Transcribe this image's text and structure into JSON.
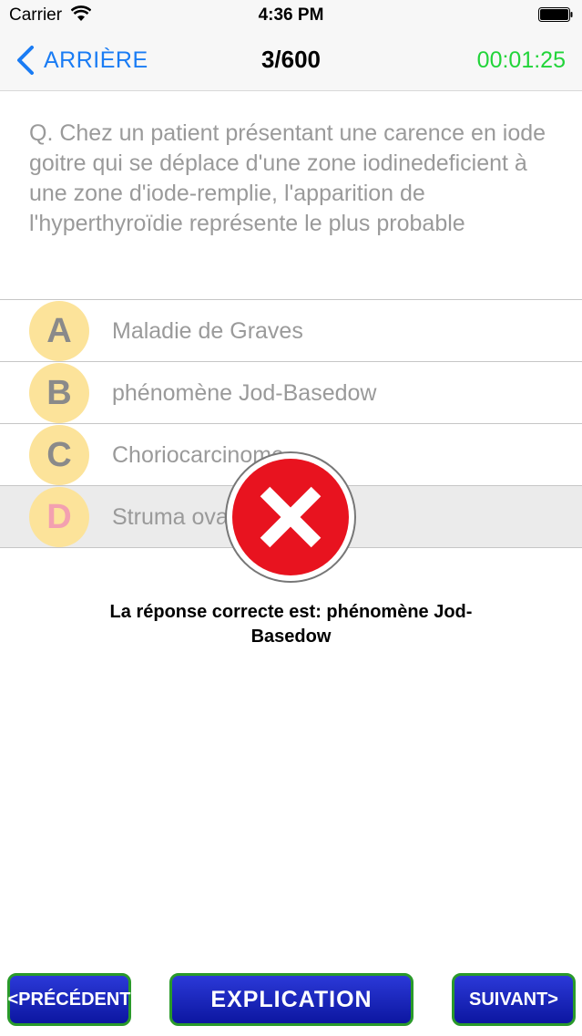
{
  "status_bar": {
    "carrier": "Carrier",
    "time": "4:36 PM"
  },
  "nav": {
    "back_label": "ARRIÈRE",
    "progress": "3/600",
    "timer": "00:01:25"
  },
  "question": {
    "text": "Q. Chez un patient présentant une carence en iode goitre qui se déplace d'une zone iodinedeficient à une zone d'iode-remplie, l'apparition de l'hyperthyroïdie représente le plus probable"
  },
  "options": [
    {
      "letter": "A",
      "text": "Maladie de Graves"
    },
    {
      "letter": "B",
      "text": "phénomène Jod-Basedow"
    },
    {
      "letter": "C",
      "text": "Choriocarcinome"
    },
    {
      "letter": "D",
      "text": "Struma ovarii",
      "selected": true
    }
  ],
  "answer": {
    "text": "La réponse correcte est:  phénomène Jod-Basedow"
  },
  "buttons": {
    "prev": "<PRÉCÉDENT",
    "explanation": "EXPLICATION",
    "next": "SUIVANT>"
  },
  "colors": {
    "accent": "#1a7cf4",
    "timer": "#22d43a",
    "wrong": "#e8131f",
    "button": "#1a28c4"
  },
  "icons": {
    "back": "chevron-left-icon",
    "result": "wrong-x-icon"
  }
}
